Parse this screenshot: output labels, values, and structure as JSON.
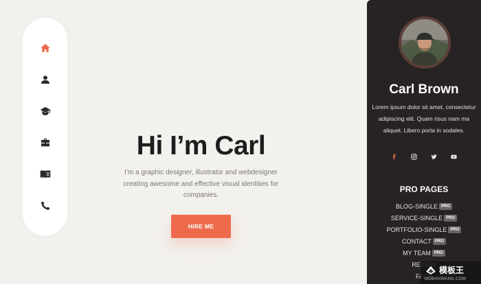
{
  "colors": {
    "accent": "#ee6a4c",
    "nav_icon": "#2b2b2b",
    "panel_bg": "#272223",
    "page_bg": "#f3f1ed"
  },
  "nav": {
    "items": [
      {
        "icon": "home-icon",
        "active": true
      },
      {
        "icon": "user-icon",
        "active": false
      },
      {
        "icon": "graduation-cap-icon",
        "active": false
      },
      {
        "icon": "briefcase-icon",
        "active": false
      },
      {
        "icon": "book-icon",
        "active": false
      },
      {
        "icon": "phone-icon",
        "active": false
      }
    ]
  },
  "hero": {
    "title": "Hi I’m Carl",
    "description": "I’m a graphic designer, illustrator and webdesigner creating awesome and effective visual identities for companies.",
    "button_label": "HIRE ME"
  },
  "profile": {
    "name": "Carl Brown",
    "bio": "Lorem ipsum dolor sit amet, consectetur adipiscing elit. Quam risus nam ma aliquet. Libero porta in sodales.",
    "socials": [
      "facebook-icon",
      "instagram-icon",
      "twitter-icon",
      "youtube-icon"
    ]
  },
  "pro_pages": {
    "title": "PRO PAGES",
    "badge": "PRO",
    "items": [
      {
        "label": "BLOG-SINGLE",
        "pro": true
      },
      {
        "label": "SERVICE-SINGLE",
        "pro": true
      },
      {
        "label": "PORTFOLIO-SINGLE",
        "pro": true
      },
      {
        "label": "CONTACT",
        "pro": true
      },
      {
        "label": "MY TEAM",
        "pro": true
      },
      {
        "label": "REVIEW",
        "pro": false
      },
      {
        "label": "FAQS",
        "pro": false
      }
    ]
  },
  "watermark": {
    "cn": "模板王",
    "en": "MOBANWANG.COM"
  }
}
